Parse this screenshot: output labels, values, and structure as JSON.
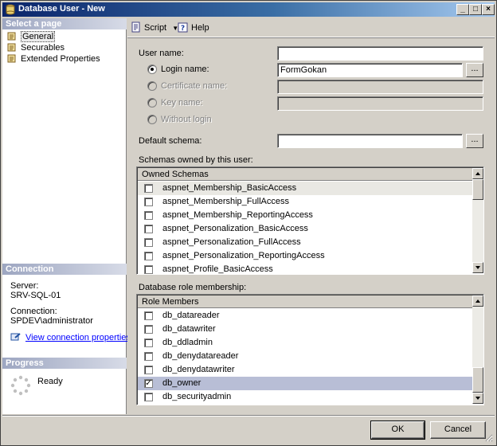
{
  "window": {
    "title": "Database User - New"
  },
  "left_panel": {
    "select_page_header": "Select a page",
    "pages": [
      {
        "label": "General",
        "selected": true
      },
      {
        "label": "Securables",
        "selected": false
      },
      {
        "label": "Extended Properties",
        "selected": false
      }
    ],
    "connection_header": "Connection",
    "server_label": "Server:",
    "server_value": "SRV-SQL-01",
    "connection_label": "Connection:",
    "connection_value": "SPDEV\\administrator",
    "view_connection_link": "View connection properties",
    "progress_header": "Progress",
    "progress_status": "Ready"
  },
  "toolbar": {
    "script_label": "Script",
    "help_label": "Help"
  },
  "form": {
    "user_name_label": "User name:",
    "user_name_value": "",
    "login_name_label": "Login name:",
    "login_name_value": "FormGokan",
    "certificate_name_label": "Certificate name:",
    "key_name_label": "Key name:",
    "without_login_label": "Without login",
    "default_schema_label": "Default schema:",
    "default_schema_value": "",
    "browse_label": "...",
    "selected_option": "login_name"
  },
  "schemas": {
    "section_label": "Schemas owned by this user:",
    "column_header": "Owned Schemas",
    "rows": [
      {
        "name": "aspnet_Membership_BasicAccess",
        "checked": false,
        "focus": true
      },
      {
        "name": "aspnet_Membership_FullAccess",
        "checked": false
      },
      {
        "name": "aspnet_Membership_ReportingAccess",
        "checked": false
      },
      {
        "name": "aspnet_Personalization_BasicAccess",
        "checked": false
      },
      {
        "name": "aspnet_Personalization_FullAccess",
        "checked": false
      },
      {
        "name": "aspnet_Personalization_ReportingAccess",
        "checked": false
      },
      {
        "name": "aspnet_Profile_BasicAccess",
        "checked": false
      }
    ]
  },
  "roles": {
    "section_label": "Database role membership:",
    "column_header": "Role Members",
    "rows": [
      {
        "name": "db_datareader",
        "checked": false
      },
      {
        "name": "db_datawriter",
        "checked": false
      },
      {
        "name": "db_ddladmin",
        "checked": false
      },
      {
        "name": "db_denydatareader",
        "checked": false
      },
      {
        "name": "db_denydatawriter",
        "checked": false
      },
      {
        "name": "db_owner",
        "checked": true,
        "selected": true
      },
      {
        "name": "db_securityadmin",
        "checked": false
      }
    ]
  },
  "buttons": {
    "ok_label": "OK",
    "cancel_label": "Cancel"
  },
  "colors": {
    "title_start": "#0a246a",
    "title_end": "#a6caf0",
    "section_header": "#9da6c1",
    "selected_row": "#b8bed6",
    "link": "#0000ff"
  }
}
